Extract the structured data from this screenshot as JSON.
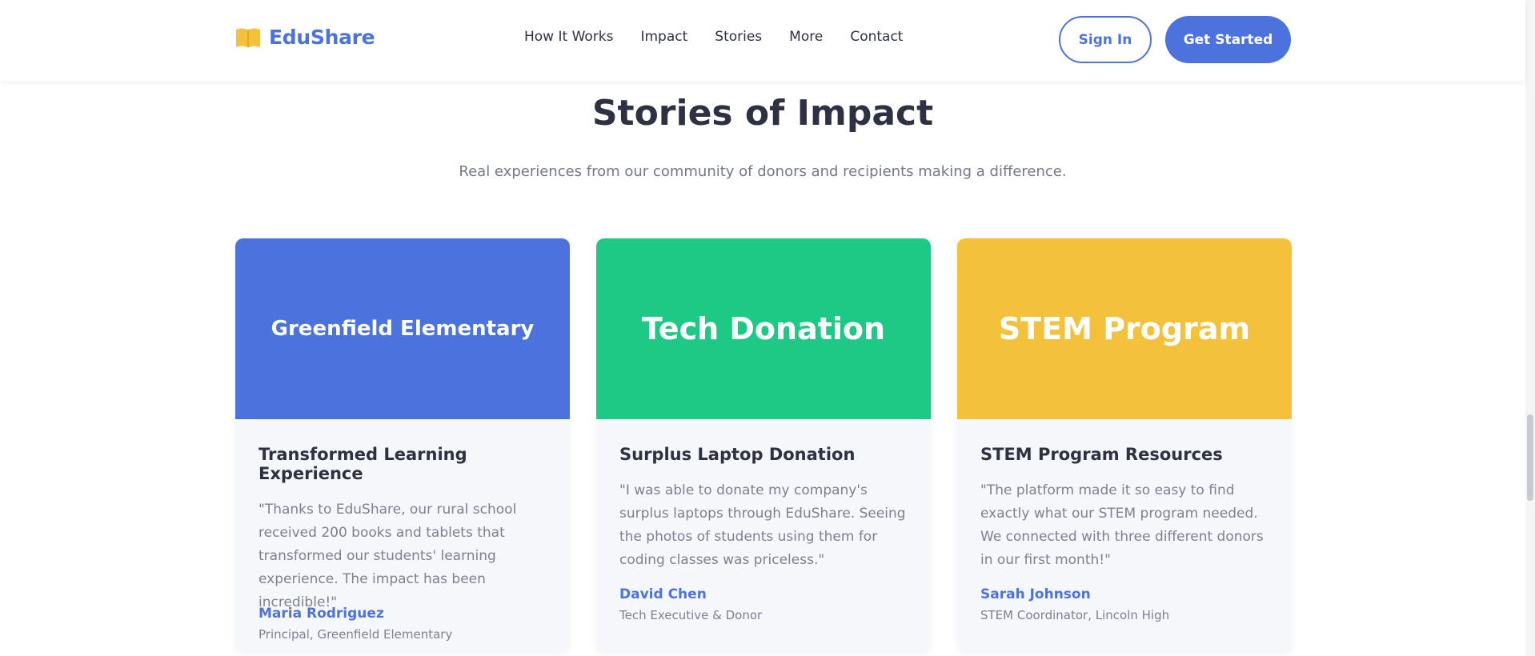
{
  "colors": {
    "primary": "#4c72de",
    "green": "#1ec986",
    "yellow": "#f4c13c",
    "text_dark": "#2d3142",
    "text_muted": "#747887"
  },
  "header": {
    "logo_icon": "open-book-icon",
    "brand": "EduShare",
    "nav": [
      "How It Works",
      "Impact",
      "Stories",
      "More",
      "Contact"
    ],
    "sign_in": "Sign In",
    "get_started": "Get Started"
  },
  "section": {
    "title": "Stories of Impact",
    "subtitle": "Real experiences from our community of donors and recipients making a difference."
  },
  "stories": [
    {
      "banner": "Greenfield Elementary",
      "banner_color": "#4c72de",
      "title": "Transformed Learning Experience",
      "quote": "\"Thanks to EduShare, our rural school received 200 books and tablets that transformed our students' learning experience. The impact has been incredible!\"",
      "author": "Maria Rodriguez",
      "role": "Principal, Greenfield Elementary"
    },
    {
      "banner": "Tech Donation",
      "banner_color": "#1ec986",
      "title": "Surplus Laptop Donation",
      "quote": "\"I was able to donate my company's surplus laptops through EduShare. Seeing the photos of students using them for coding classes was priceless.\"",
      "author": "David Chen",
      "role": "Tech Executive & Donor"
    },
    {
      "banner": "STEM Program",
      "banner_color": "#f4c13c",
      "title": "STEM Program Resources",
      "quote": "\"The platform made it so easy to find exactly what our STEM program needed. We connected with three different donors in our first month!\"",
      "author": "Sarah Johnson",
      "role": "STEM Coordinator, Lincoln High"
    }
  ]
}
